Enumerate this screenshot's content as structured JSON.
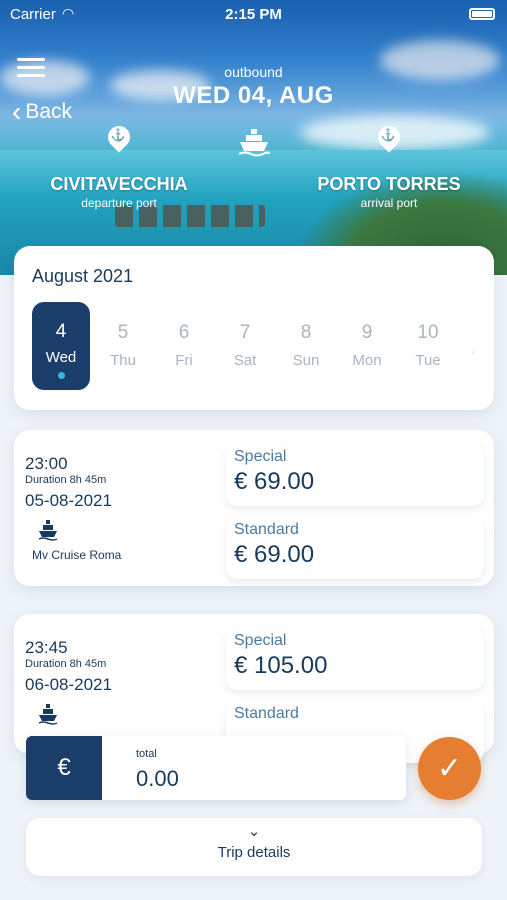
{
  "status_bar": {
    "carrier": "Carrier",
    "time": "2:15 PM"
  },
  "header": {
    "back_label": "Back",
    "direction": "outbound",
    "date": "WED 04, AUG",
    "departure_port": {
      "name": "CIVITAVECCHIA",
      "label": "departure port"
    },
    "arrival_port": {
      "name": "PORTO TORRES",
      "label": "arrival port"
    }
  },
  "calendar": {
    "month": "August 2021",
    "days": [
      {
        "num": "4",
        "dow": "Wed",
        "selected": true
      },
      {
        "num": "5",
        "dow": "Thu"
      },
      {
        "num": "6",
        "dow": "Fri"
      },
      {
        "num": "7",
        "dow": "Sat"
      },
      {
        "num": "8",
        "dow": "Sun"
      },
      {
        "num": "9",
        "dow": "Mon"
      },
      {
        "num": "10",
        "dow": "Tue"
      }
    ]
  },
  "trips": [
    {
      "time": "23:00",
      "duration": "Duration 8h 45m",
      "date": "05-08-2021",
      "vessel": "Mv Cruise Roma",
      "fares": [
        {
          "name": "Special",
          "price": "€ 69.00"
        },
        {
          "name": "Standard",
          "price": "€ 69.00"
        }
      ]
    },
    {
      "time": "23:45",
      "duration": "Duration 8h 45m",
      "date": "06-08-2021",
      "vessel": "",
      "fares": [
        {
          "name": "Special",
          "price": "€ 105.00"
        },
        {
          "name": "Standard",
          "price": ""
        }
      ]
    }
  ],
  "total": {
    "currency": "€",
    "label": "total",
    "value": "0.00"
  },
  "footer": {
    "details_label": "Trip details"
  },
  "colors": {
    "navy": "#1b3d6a",
    "accent": "#e67e32",
    "dot": "#31b6e8"
  }
}
